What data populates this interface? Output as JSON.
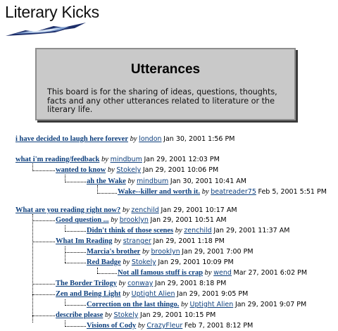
{
  "logo": {
    "title": "Literary Kicks"
  },
  "board": {
    "title": "Utterances",
    "description": "This board is for the sharing of ideas, questions, thoughts, facts and any other utterances related to literature or the literary life."
  },
  "by_word": "by",
  "posts": [
    {
      "title": "i have decided to laugh here forever",
      "author": "london",
      "date": "Jan 30, 2001 1:56 PM"
    },
    {
      "title": "what i'm reading/feedback",
      "author": "mindbum",
      "date": "Jan 29, 2001 12:03 PM"
    },
    {
      "title": "wanted to know",
      "author": "Stokely",
      "date": "Jan 29, 2001 10:06 PM"
    },
    {
      "title": "ah the Wake",
      "author": "mindbum",
      "date": "Jan 30, 2001 10:41 AM"
    },
    {
      "title": "Wake--killer and worth it.",
      "author": "beatreader75",
      "date": "Feb 5, 2001 5:51 PM"
    },
    {
      "title": "What are you reading right now?",
      "author": "zenchild",
      "date": "Jan 29, 2001 10:17 AM"
    },
    {
      "title": "Good question ...",
      "author": "brooklyn",
      "date": "Jan 29, 2001 10:51 AM"
    },
    {
      "title": "Didn't think of those scenes",
      "author": "zenchild",
      "date": "Jan 29, 2001 11:37 AM"
    },
    {
      "title": "What Im Reading",
      "author": "stranger",
      "date": "Jan 29, 2001 1:18 PM"
    },
    {
      "title": "Marcia's brother",
      "author": "brooklyn",
      "date": "Jan 29, 2001 7:00 PM"
    },
    {
      "title": "Red Badge",
      "author": "Stokely",
      "date": "Jan 29, 2001 10:09 PM"
    },
    {
      "title": "Not all famous stuff is crap",
      "author": "wend",
      "date": "Mar 27, 2001 6:02 PM"
    },
    {
      "title": "The Border Trilogy",
      "author": "conway",
      "date": "Jan 29, 2001 8:18 PM"
    },
    {
      "title": "Zen and Being Light",
      "author": "Uptight Alien",
      "date": "Jan 29, 2001 9:05 PM"
    },
    {
      "title": "Correction on the last thingo.",
      "author": "Uptight Alien",
      "date": "Jan 29, 2001 9:07 PM"
    },
    {
      "title": "describe please",
      "author": "Stokely",
      "date": "Jan 29, 2001 10:15 PM"
    },
    {
      "title": "Visions of Cody",
      "author": "CrazyFleur",
      "date": "Feb 7, 2001 8:12 PM"
    }
  ]
}
